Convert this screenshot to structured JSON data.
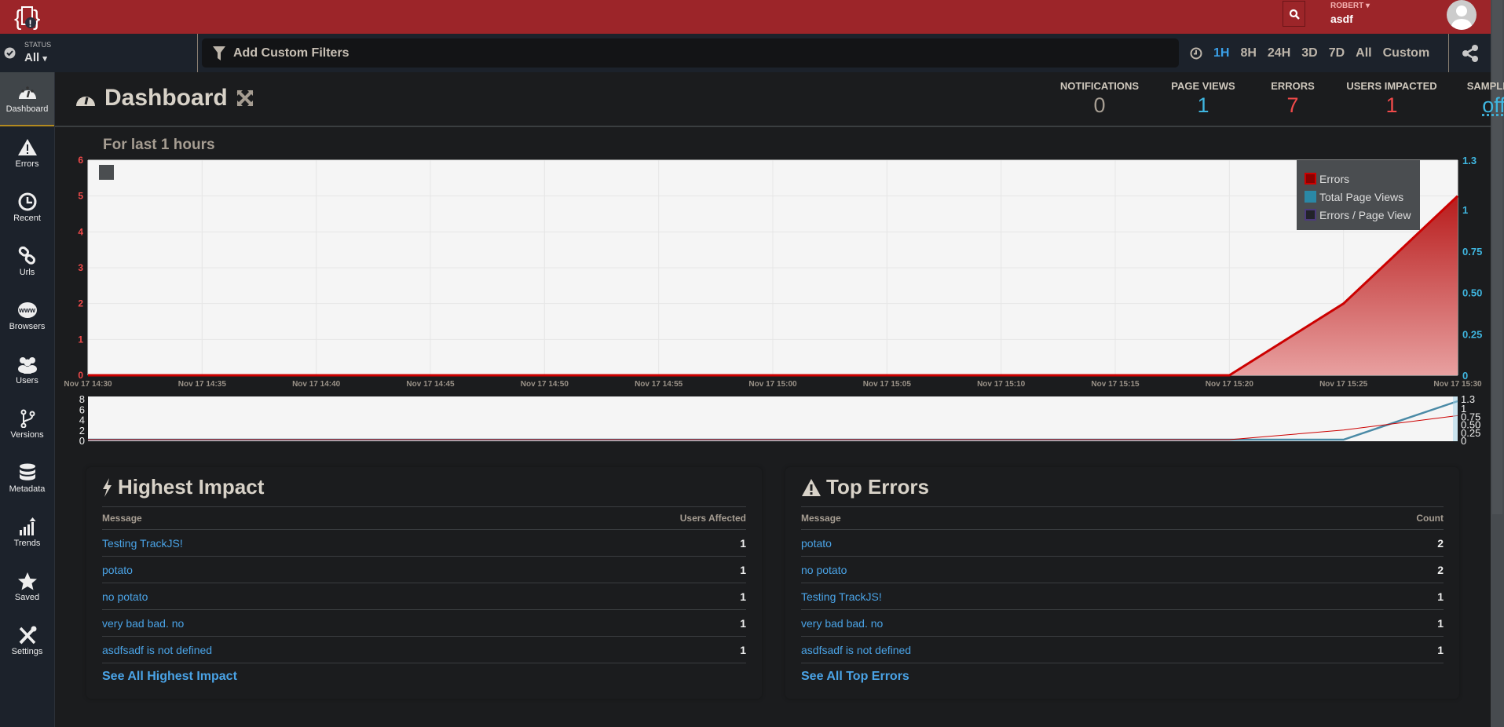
{
  "header": {
    "user_name": "ROBERT",
    "org": "asdf"
  },
  "filters": {
    "status_label": "STATUS",
    "status_value": "All",
    "custom_filters_placeholder": "Add Custom Filters",
    "time_ranges": [
      "1H",
      "8H",
      "24H",
      "3D",
      "7D",
      "All",
      "Custom"
    ],
    "active_range": "1H"
  },
  "sidebar": {
    "items": [
      {
        "label": "Dashboard",
        "icon": "dashboard-icon"
      },
      {
        "label": "Errors",
        "icon": "warning-icon"
      },
      {
        "label": "Recent",
        "icon": "clock-icon"
      },
      {
        "label": "Urls",
        "icon": "link-icon"
      },
      {
        "label": "Browsers",
        "icon": "www-icon"
      },
      {
        "label": "Users",
        "icon": "users-icon"
      },
      {
        "label": "Versions",
        "icon": "branch-icon"
      },
      {
        "label": "Metadata",
        "icon": "database-icon"
      },
      {
        "label": "Trends",
        "icon": "trends-icon"
      },
      {
        "label": "Saved",
        "icon": "star-icon"
      },
      {
        "label": "Settings",
        "icon": "tools-icon"
      }
    ],
    "active": "Dashboard"
  },
  "page": {
    "title": "Dashboard",
    "chart_title": "For last 1 hours"
  },
  "stats": [
    {
      "label": "NOTIFICATIONS",
      "value": "0",
      "color": "#a69d92"
    },
    {
      "label": "PAGE VIEWS",
      "value": "1",
      "color": "#3fb6e0"
    },
    {
      "label": "ERRORS",
      "value": "7",
      "color": "#f04a4a"
    },
    {
      "label": "USERS IMPACTED",
      "value": "1",
      "color": "#f04a4a"
    },
    {
      "label": "SAMPLING",
      "value": "off",
      "color": "#3fb6e0"
    }
  ],
  "chart_data": {
    "type": "area",
    "x": [
      "Nov 17 14:30",
      "Nov 17 14:35",
      "Nov 17 14:40",
      "Nov 17 14:45",
      "Nov 17 14:50",
      "Nov 17 14:55",
      "Nov 17 15:00",
      "Nov 17 15:05",
      "Nov 17 15:10",
      "Nov 17 15:15",
      "Nov 17 15:20",
      "Nov 17 15:25",
      "Nov 17 15:30"
    ],
    "series": [
      {
        "name": "Errors",
        "axis": "left",
        "color": "#b81c1c",
        "values": [
          0,
          0,
          0,
          0,
          0,
          0,
          0,
          0,
          0,
          0,
          0,
          2,
          5
        ]
      },
      {
        "name": "Total Page Views",
        "axis": "right",
        "color": "#2a88a6",
        "values": [
          0,
          0,
          0,
          0,
          0,
          0,
          0,
          0,
          0,
          0,
          0,
          0,
          1
        ]
      },
      {
        "name": "Errors / Page View",
        "axis": "right",
        "color": "#22232a",
        "values": []
      }
    ],
    "y_left": {
      "ticks": [
        "0",
        "1",
        "2",
        "3",
        "4",
        "5",
        "6"
      ],
      "range": [
        0,
        6
      ],
      "color": "#f04a4a"
    },
    "y_right": {
      "ticks": [
        "0",
        "0.25",
        "0.50",
        "0.75",
        "1",
        "1.3"
      ],
      "range": [
        0,
        1.3
      ],
      "color": "#3fb6e0"
    },
    "navigator": {
      "y_left_ticks": [
        "0",
        "2",
        "4",
        "6",
        "8"
      ],
      "y_right_ticks": [
        "0",
        "0.25",
        "0.50",
        "0.75",
        "1",
        "1.3"
      ]
    },
    "legend_position": "top-right",
    "grid": true
  },
  "highest_impact": {
    "title": "Highest Impact",
    "col_message": "Message",
    "col_value": "Users Affected",
    "rows": [
      {
        "message": "Testing TrackJS!",
        "value": "1"
      },
      {
        "message": "potato",
        "value": "1"
      },
      {
        "message": "no potato",
        "value": "1"
      },
      {
        "message": "very bad bad. no",
        "value": "1"
      },
      {
        "message": "asdfsadf is not defined",
        "value": "1"
      }
    ],
    "see_all": "See All Highest Impact"
  },
  "top_errors": {
    "title": "Top Errors",
    "col_message": "Message",
    "col_value": "Count",
    "rows": [
      {
        "message": "potato",
        "value": "2"
      },
      {
        "message": "no potato",
        "value": "2"
      },
      {
        "message": "Testing TrackJS!",
        "value": "1"
      },
      {
        "message": "very bad bad. no",
        "value": "1"
      },
      {
        "message": "asdfsadf is not defined",
        "value": "1"
      }
    ],
    "see_all": "See All Top Errors"
  }
}
